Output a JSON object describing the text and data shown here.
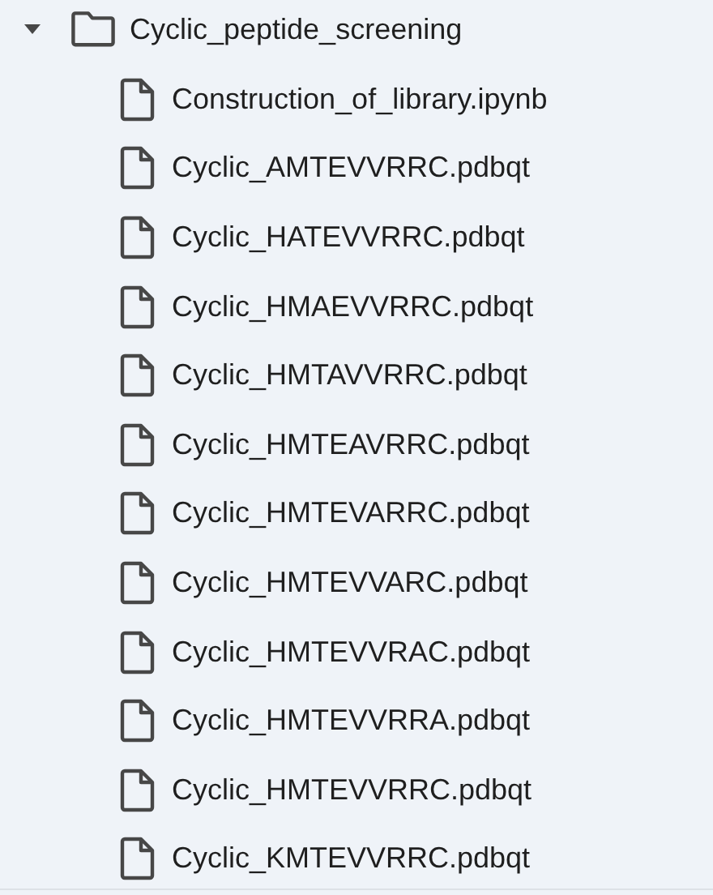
{
  "tree": {
    "name": "Cyclic_peptide_screening",
    "expanded": true,
    "children": [
      {
        "name": "Construction_of_library.ipynb"
      },
      {
        "name": "Cyclic_AMTEVVRRC.pdbqt"
      },
      {
        "name": "Cyclic_HATEVVRRC.pdbqt"
      },
      {
        "name": "Cyclic_HMAEVVRRC.pdbqt"
      },
      {
        "name": "Cyclic_HMTAVVRRC.pdbqt"
      },
      {
        "name": "Cyclic_HMTEAVRRC.pdbqt"
      },
      {
        "name": "Cyclic_HMTEVARRC.pdbqt"
      },
      {
        "name": "Cyclic_HMTEVVARC.pdbqt"
      },
      {
        "name": "Cyclic_HMTEVVRAC.pdbqt"
      },
      {
        "name": "Cyclic_HMTEVVRRA.pdbqt"
      },
      {
        "name": "Cyclic_HMTEVVRRC.pdbqt"
      },
      {
        "name": "Cyclic_KMTEVVRRC.pdbqt"
      }
    ]
  }
}
